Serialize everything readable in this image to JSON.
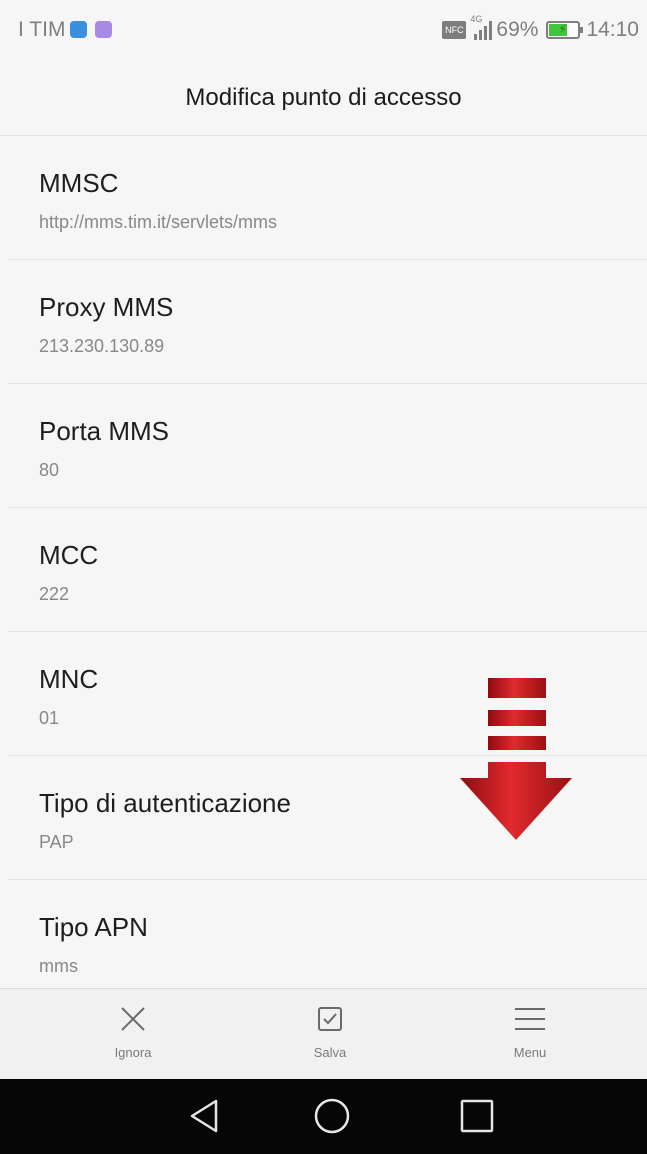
{
  "status_bar": {
    "carrier": "I TIM",
    "battery_percent": "69%",
    "battery_level": 0.69,
    "time": "14:10",
    "network": "4G",
    "nfc_label": "NFC",
    "icons": [
      "notification-app-icon",
      "notification-app-icon",
      "nfc-icon",
      "signal-icon",
      "battery-icon"
    ]
  },
  "header": {
    "title": "Modifica punto di accesso"
  },
  "fields": [
    {
      "label": "MMSC",
      "value": "http://mms.tim.it/servlets/mms"
    },
    {
      "label": "Proxy MMS",
      "value": "213.230.130.89"
    },
    {
      "label": "Porta MMS",
      "value": "80"
    },
    {
      "label": "MCC",
      "value": "222"
    },
    {
      "label": "MNC",
      "value": "01"
    },
    {
      "label": "Tipo di autenticazione",
      "value": "PAP"
    },
    {
      "label": "Tipo APN",
      "value": "mms"
    }
  ],
  "actions": {
    "discard": {
      "label": "Ignora",
      "icon": "close-icon"
    },
    "save": {
      "label": "Salva",
      "icon": "checkbox-check-icon"
    },
    "menu": {
      "label": "Menu",
      "icon": "menu-icon"
    }
  },
  "nav": {
    "icons": [
      "back-icon",
      "home-icon",
      "recents-icon"
    ]
  },
  "colors": {
    "background": "#f6f6f6",
    "nav_bar": "#060606",
    "battery": "#3fc63f",
    "arrow": "#c8161d"
  }
}
